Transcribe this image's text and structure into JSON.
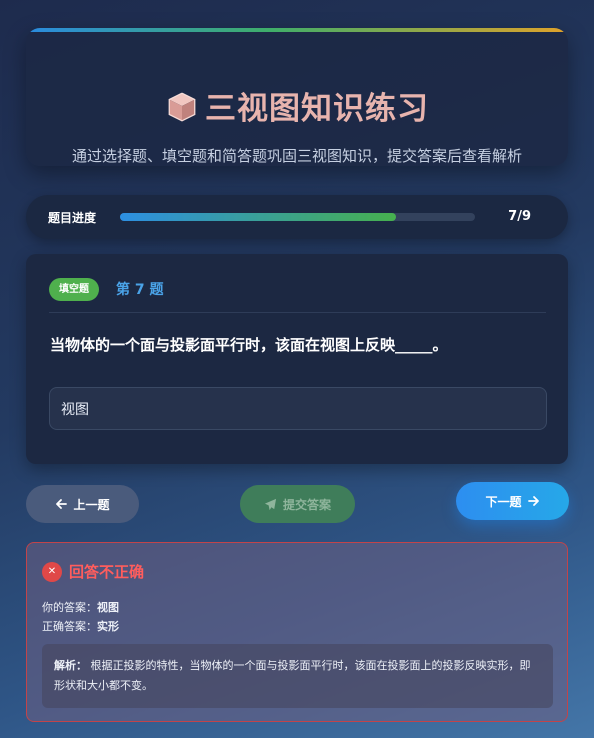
{
  "header": {
    "title": "三视图知识练习",
    "subtitle": "通过选择题、填空题和简答题巩固三视图知识，提交答案后查看解析"
  },
  "progress": {
    "label": "题目进度",
    "count_text": "7/9",
    "fraction": 0.778
  },
  "question": {
    "type_badge": "填空题",
    "number_label": "第 7 题",
    "text": "当物体的一个面与投影面平行时，该面在视图上反映_____。",
    "answer_value": "视图"
  },
  "nav": {
    "prev_label": "上一题",
    "submit_label": "提交答案",
    "next_label": "下一题"
  },
  "result": {
    "title": "回答不正确",
    "your_answer_label": "你的答案：",
    "your_answer": "视图",
    "correct_answer_label": "正确答案：",
    "correct_answer": "实形",
    "explanation_label": "解析：",
    "explanation": "根据正投影的特性，当物体的一个面与投影面平行时，该面在投影面上的投影反映实形，即形状和大小都不变。"
  },
  "icons": {
    "title_icon": "cube-icon",
    "prev_icon": "arrow-left-icon",
    "submit_icon": "paper-plane-icon",
    "next_icon": "arrow-right-icon",
    "result_icon": "x-circle-icon"
  },
  "colors": {
    "accent_blue": "#2d8ef0",
    "success_green": "#4fb04d",
    "error_red": "#e04848",
    "title_pink": "#e8b4ae"
  }
}
